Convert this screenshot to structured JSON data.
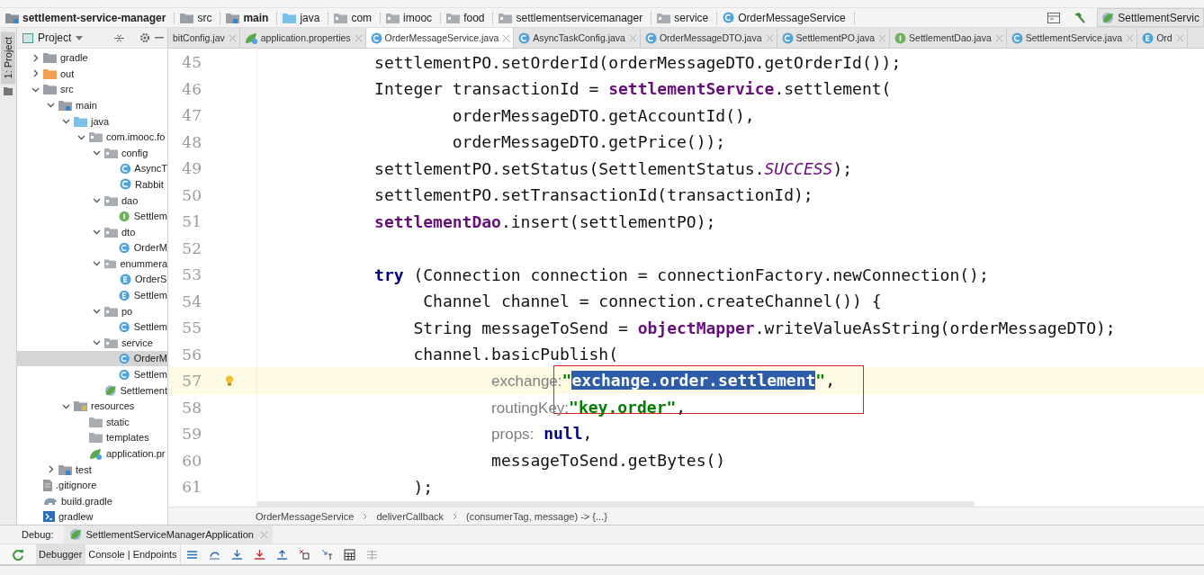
{
  "navbar": {
    "crumbs": [
      {
        "label": "settlement-service-manager",
        "kind": "module"
      },
      {
        "label": "src",
        "kind": "folder"
      },
      {
        "label": "main",
        "kind": "source-root"
      },
      {
        "label": "java",
        "kind": "java-root"
      },
      {
        "label": "com",
        "kind": "package"
      },
      {
        "label": "imooc",
        "kind": "package"
      },
      {
        "label": "food",
        "kind": "package"
      },
      {
        "label": "settlementservicemanager",
        "kind": "package"
      },
      {
        "label": "service",
        "kind": "package"
      },
      {
        "label": "OrderMessageService",
        "kind": "class"
      }
    ],
    "run_config": "SettlementServic"
  },
  "tool_strip": {
    "label": "1: Project"
  },
  "project": {
    "title": "Project",
    "tree": [
      {
        "label": "gradle",
        "kind": "folder",
        "expanded": false,
        "selected": false
      },
      {
        "label": "out",
        "kind": "excluded-folder",
        "expanded": false,
        "selected": false
      },
      {
        "label": "src",
        "kind": "folder",
        "expanded": true,
        "selected": false,
        "children": [
          {
            "label": "main",
            "kind": "source-root",
            "expanded": true,
            "selected": false,
            "children": [
              {
                "label": "java",
                "kind": "java-root",
                "expanded": true,
                "selected": false,
                "children": [
                  {
                    "label": "com.imooc.fo",
                    "kind": "package",
                    "expanded": true,
                    "selected": false,
                    "children": [
                      {
                        "label": "config",
                        "kind": "package",
                        "expanded": true,
                        "selected": false,
                        "children": [
                          {
                            "label": "AsyncT",
                            "kind": "class",
                            "selected": false
                          },
                          {
                            "label": "Rabbit",
                            "kind": "class",
                            "selected": false
                          }
                        ]
                      },
                      {
                        "label": "dao",
                        "kind": "package",
                        "expanded": true,
                        "selected": false,
                        "children": [
                          {
                            "label": "Settlem",
                            "kind": "interface",
                            "selected": false
                          }
                        ]
                      },
                      {
                        "label": "dto",
                        "kind": "package",
                        "expanded": true,
                        "selected": false,
                        "children": [
                          {
                            "label": "OrderM",
                            "kind": "class",
                            "selected": false
                          }
                        ]
                      },
                      {
                        "label": "enummera",
                        "kind": "package",
                        "expanded": true,
                        "selected": false,
                        "children": [
                          {
                            "label": "OrderS",
                            "kind": "enum",
                            "selected": false
                          },
                          {
                            "label": "Settlem",
                            "kind": "enum",
                            "selected": false
                          }
                        ]
                      },
                      {
                        "label": "po",
                        "kind": "package",
                        "expanded": true,
                        "selected": false,
                        "children": [
                          {
                            "label": "Settlem",
                            "kind": "class",
                            "selected": false
                          }
                        ]
                      },
                      {
                        "label": "service",
                        "kind": "package",
                        "expanded": true,
                        "selected": false,
                        "children": [
                          {
                            "label": "OrderM",
                            "kind": "class",
                            "selected": true
                          },
                          {
                            "label": "Settlem",
                            "kind": "class",
                            "selected": false
                          }
                        ]
                      },
                      {
                        "label": "Settlement",
                        "kind": "spring",
                        "selected": false
                      }
                    ]
                  }
                ]
              },
              {
                "label": "resources",
                "kind": "resources-root",
                "expanded": true,
                "selected": false,
                "children": [
                  {
                    "label": "static",
                    "kind": "plain-folder",
                    "selected": false
                  },
                  {
                    "label": "templates",
                    "kind": "plain-folder",
                    "selected": false
                  },
                  {
                    "label": "application.pr",
                    "kind": "properties",
                    "selected": false
                  }
                ]
              }
            ]
          },
          {
            "label": "test",
            "kind": "source-root",
            "expanded": false,
            "selected": false
          }
        ]
      },
      {
        "label": ".gitignore",
        "kind": "file",
        "selected": false
      },
      {
        "label": "build.gradle",
        "kind": "gradle",
        "selected": false
      },
      {
        "label": "gradlew",
        "kind": "script",
        "selected": false
      }
    ]
  },
  "editor": {
    "tabs": [
      {
        "label": "bitConfig.jav",
        "kind": "none",
        "selected": false
      },
      {
        "label": "application.properties",
        "kind": "properties",
        "selected": false
      },
      {
        "label": "OrderMessageService.java",
        "kind": "class",
        "selected": true
      },
      {
        "label": "AsyncTaskConfig.java",
        "kind": "class",
        "selected": false
      },
      {
        "label": "OrderMessageDTO.java",
        "kind": "class",
        "selected": false
      },
      {
        "label": "SettlementPO.java",
        "kind": "class",
        "selected": false
      },
      {
        "label": "SettlementDao.java",
        "kind": "interface",
        "selected": false
      },
      {
        "label": "SettlementService.java",
        "kind": "class",
        "selected": false
      },
      {
        "label": "Ord",
        "kind": "enum",
        "selected": false
      }
    ],
    "lines": [
      {
        "number": "45",
        "current": false,
        "callout": false,
        "tokens": [
          {
            "kind": "plain",
            "text": "            settlementPO.setOrderId(orderMessageDTO.getOrderId());"
          }
        ]
      },
      {
        "number": "46",
        "current": false,
        "callout": false,
        "tokens": [
          {
            "kind": "plain",
            "text": "            Integer transactionId = "
          },
          {
            "kind": "field",
            "text": "settlementService"
          },
          {
            "kind": "plain",
            "text": ".settlement("
          }
        ]
      },
      {
        "number": "47",
        "current": false,
        "callout": false,
        "tokens": [
          {
            "kind": "plain",
            "text": "                    orderMessageDTO.getAccountId(),"
          }
        ]
      },
      {
        "number": "48",
        "current": false,
        "callout": false,
        "tokens": [
          {
            "kind": "plain",
            "text": "                    orderMessageDTO.getPrice());"
          }
        ]
      },
      {
        "number": "49",
        "current": false,
        "callout": false,
        "tokens": [
          {
            "kind": "plain",
            "text": "            settlementPO.setStatus(SettlementStatus."
          },
          {
            "kind": "static",
            "text": "SUCCESS"
          },
          {
            "kind": "plain",
            "text": ");"
          }
        ]
      },
      {
        "number": "50",
        "current": false,
        "callout": false,
        "tokens": [
          {
            "kind": "plain",
            "text": "            settlementPO.setTransactionId(transactionId);"
          }
        ]
      },
      {
        "number": "51",
        "current": false,
        "callout": false,
        "tokens": [
          {
            "kind": "field",
            "text": "            settlementDao"
          },
          {
            "kind": "plain",
            "text": ".insert(settlementPO);"
          }
        ]
      },
      {
        "number": "52",
        "current": false,
        "callout": false
      },
      {
        "number": "53",
        "current": false,
        "callout": false,
        "tokens": [
          {
            "kind": "keyword",
            "text": "            try"
          },
          {
            "kind": "plain",
            "text": " (Connection connection = connectionFactory.newConnection();"
          }
        ]
      },
      {
        "number": "54",
        "current": false,
        "callout": false,
        "tokens": [
          {
            "kind": "plain",
            "text": "                 Channel channel = connection.createChannel()) {"
          }
        ]
      },
      {
        "number": "55",
        "current": false,
        "callout": false,
        "tokens": [
          {
            "kind": "plain",
            "text": "                String messageToSend = "
          },
          {
            "kind": "field",
            "text": "objectMapper"
          },
          {
            "kind": "plain",
            "text": ".writeValueAsString(orderMessageDTO);"
          }
        ]
      },
      {
        "number": "56",
        "current": false,
        "callout": false,
        "tokens": [
          {
            "kind": "plain",
            "text": "                channel.basicPublish("
          }
        ]
      },
      {
        "number": "57",
        "current": true,
        "callout": true,
        "tokens": [
          {
            "kind": "hint",
            "text": "                        exchange:"
          },
          {
            "kind": "string",
            "text": "\""
          },
          {
            "kind": "selection",
            "text": "exchange.order.settlement"
          },
          {
            "kind": "string",
            "text": "\""
          },
          {
            "kind": "plain",
            "text": ","
          }
        ]
      },
      {
        "number": "58",
        "current": false,
        "callout": false,
        "tokens": [
          {
            "kind": "hint",
            "text": "                        routingKey:"
          },
          {
            "kind": "string",
            "text": "\"key.order\""
          },
          {
            "kind": "plain",
            "text": ","
          }
        ]
      },
      {
        "number": "59",
        "current": false,
        "callout": false,
        "tokens": [
          {
            "kind": "hint",
            "text": "                        props:"
          },
          {
            "kind": "keyword",
            "text": " null"
          },
          {
            "kind": "plain",
            "text": ","
          }
        ]
      },
      {
        "number": "60",
        "current": false,
        "callout": false,
        "tokens": [
          {
            "kind": "plain",
            "text": "                        messageToSend.getBytes()"
          }
        ]
      },
      {
        "number": "61",
        "current": false,
        "callout": false,
        "tokens": [
          {
            "kind": "plain",
            "text": "                );"
          }
        ]
      }
    ],
    "breadcrumbs": [
      "OrderMessageService",
      "deliverCallback",
      "(consumerTag, message) -> {...}"
    ]
  },
  "debug": {
    "label": "Debug:",
    "session": "SettlementServiceManagerApplication",
    "tabs": [
      {
        "label": "Debugger",
        "selected": true
      },
      {
        "label": "Console | Endpoints",
        "selected": false
      }
    ]
  }
}
